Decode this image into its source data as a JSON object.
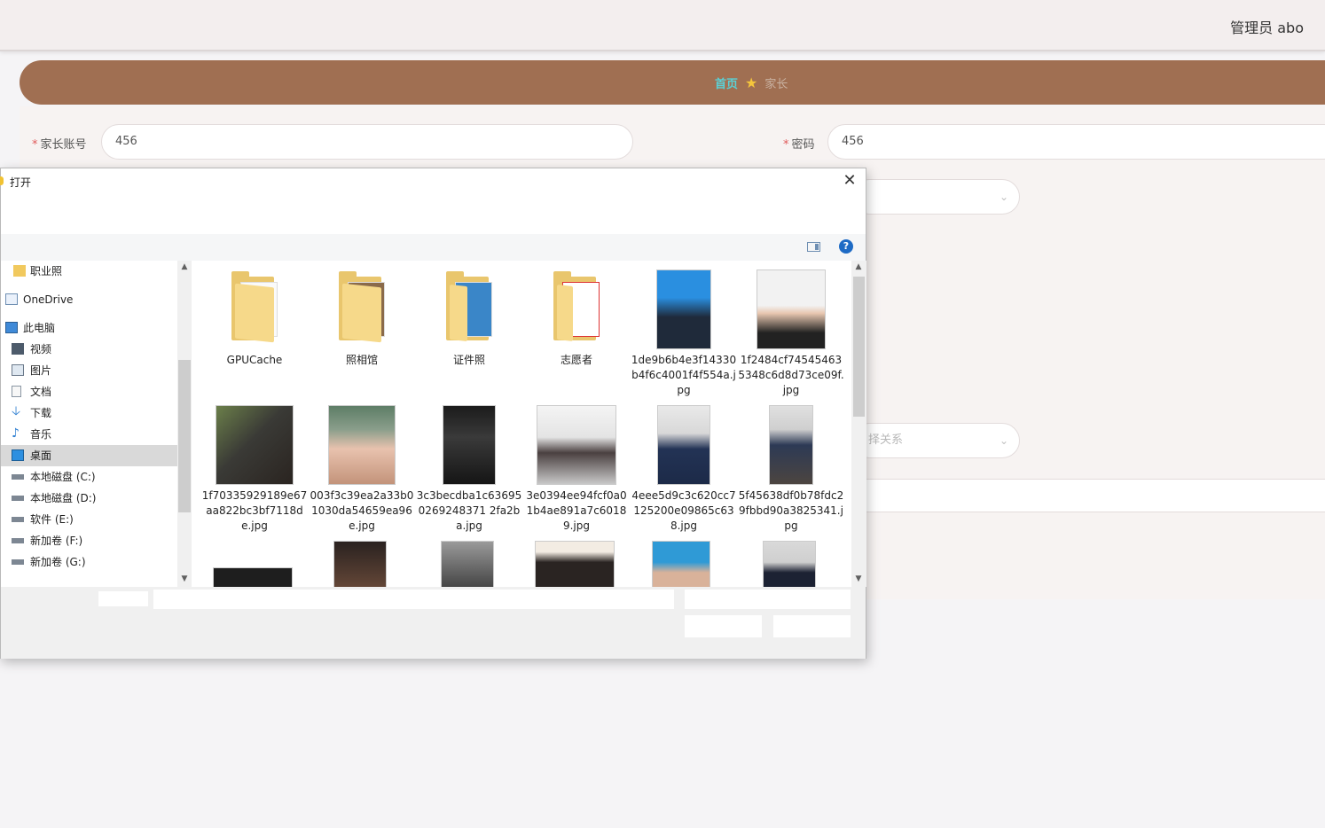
{
  "header": {
    "user_label": "管理员 abo"
  },
  "breadcrumb": {
    "home": "首页",
    "star": "★",
    "current": "家长"
  },
  "form": {
    "account_label": "家长账号",
    "account_value": "456",
    "password_label": "密码",
    "password_value": "456",
    "relation_placeholder": "择关系",
    "required_mark": "*"
  },
  "dialog": {
    "title": "打开",
    "close": "✕",
    "help": "?",
    "nav": [
      {
        "label": "职业照",
        "icon": "folder-icon"
      },
      {
        "label": "OneDrive",
        "icon": "onedrive-icon"
      },
      {
        "label": "此电脑",
        "icon": "computer-icon"
      },
      {
        "label": "视频",
        "icon": "video-icon"
      },
      {
        "label": "图片",
        "icon": "pictures-icon"
      },
      {
        "label": "文档",
        "icon": "documents-icon"
      },
      {
        "label": "下载",
        "icon": "download-icon"
      },
      {
        "label": "音乐",
        "icon": "music-icon"
      },
      {
        "label": "桌面",
        "icon": "desktop-icon",
        "selected": true
      },
      {
        "label": "本地磁盘 (C:)",
        "icon": "drive-icon"
      },
      {
        "label": "本地磁盘 (D:)",
        "icon": "drive-icon"
      },
      {
        "label": "软件 (E:)",
        "icon": "drive-icon"
      },
      {
        "label": "新加卷 (F:)",
        "icon": "drive-icon"
      },
      {
        "label": "新加卷 (G:)",
        "icon": "drive-icon"
      }
    ],
    "files": [
      {
        "name": "GPUCache",
        "kind": "folder"
      },
      {
        "name": "照相馆",
        "kind": "folder"
      },
      {
        "name": "证件照",
        "kind": "folder"
      },
      {
        "name": "志愿者",
        "kind": "folder"
      },
      {
        "name": "1de9b6b4e3f14330b4f6c4001f4f554a.jpg",
        "kind": "image"
      },
      {
        "name": "1f2484cf745454635348c6d8d73ce09f.jpg",
        "kind": "image"
      },
      {
        "name": "1f70335929189e67aa822bc3bf7118de.jpg",
        "kind": "image"
      },
      {
        "name": "003f3c39ea2a33b01030da54659ea96e.jpg",
        "kind": "image"
      },
      {
        "name": "3c3becdba1c636950269248371 2fa2ba.jpg",
        "kind": "image"
      },
      {
        "name": "3e0394ee94fcf0a01b4ae891a7c60189.jpg",
        "kind": "image"
      },
      {
        "name": "4eee5d9c3c620cc7125200e09865c638.jpg",
        "kind": "image"
      },
      {
        "name": "5f45638df0b78fdc29fbbd90a3825341.jpg",
        "kind": "image"
      }
    ]
  },
  "colors": {
    "brand_bar": "#a06f52",
    "breadcrumb_home": "#5ad1d6",
    "star": "#f5c63c",
    "required": "#e05a5a"
  }
}
